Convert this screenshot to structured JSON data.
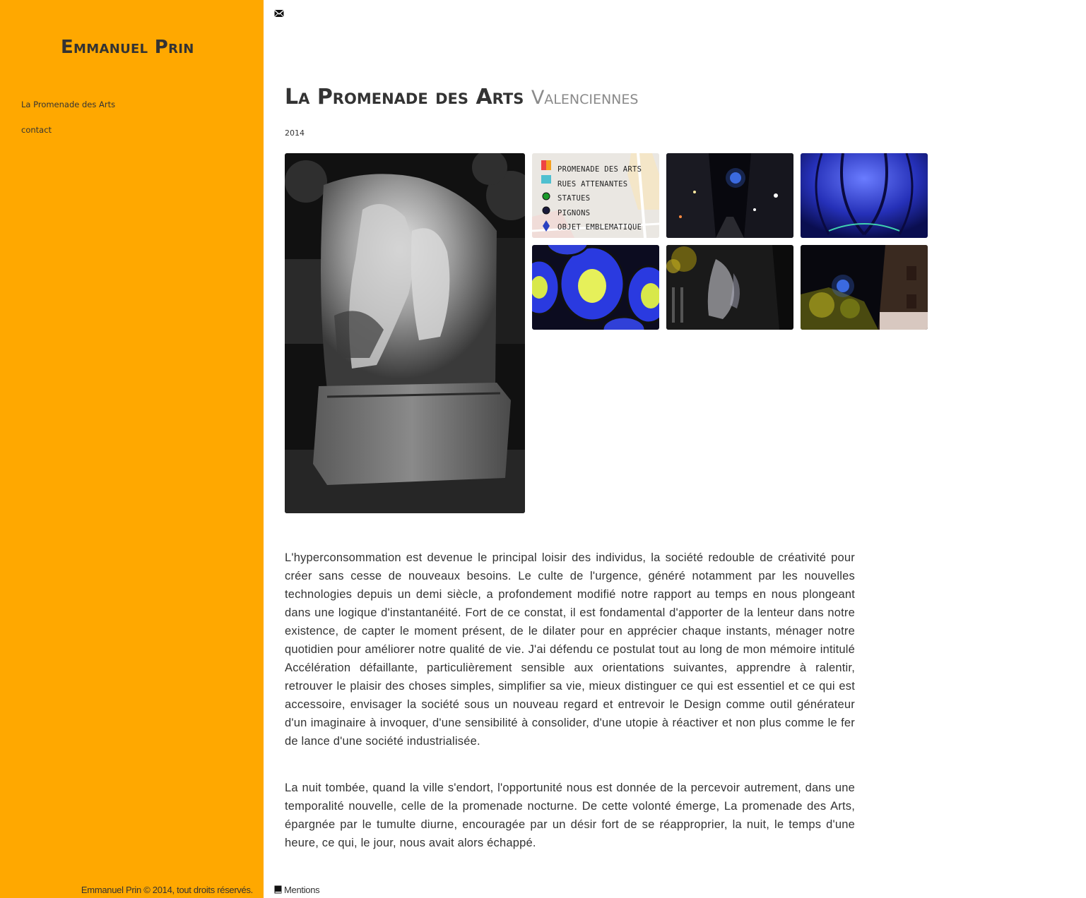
{
  "sidebar": {
    "title": "Emmanuel Prin",
    "nav": [
      {
        "label": "La Promenade des Arts"
      },
      {
        "label": "contact"
      }
    ],
    "copyright": "Emmanuel Prin © 2014, tout droits réservés."
  },
  "header": {
    "mail_icon": "envelope-icon"
  },
  "main": {
    "title": "La Promenade des Arts",
    "subtitle": "Valenciennes",
    "year": "2014",
    "map_legend": [
      "PROMENADE DES ARTS",
      "RUES ATTENANTES",
      "STATUES",
      "PIGNONS",
      "OBJET EMBLEMATIQUE"
    ],
    "paragraphs": [
      "L'hyperconsommation est devenue le principal loisir des individus, la société redouble de créativité pour créer sans cesse de nouveaux besoins. Le culte de l'urgence, généré notamment par les nouvelles technologies depuis un demi siècle, a profondement modifié notre rapport au temps en nous plongeant dans une logique d'instantanéité. Fort de ce constat, il est fondamental d'apporter de la lenteur dans notre existence, de capter le moment présent, de le dilater pour en apprécier chaque instants, ménager notre quotidien pour améliorer notre qualité de vie. J'ai défendu ce postulat tout au long de mon mémoire intitulé Accélération défaillante, particulièrement sensible aux orientations suivantes, apprendre à ralentir, retrouver le plaisir des choses simples, simplifier sa vie, mieux distinguer ce qui est essentiel et ce qui est accessoire, envisager la société sous un nouveau regard et entrevoir le Design comme outil générateur d'un imaginaire à invoquer, d'une sensibilité à consolider, d'une utopie à réactiver et non plus comme le fer de lance d'une société industrialisée.",
      "La nuit tombée, quand la ville s'endort, l'opportunité nous est donnée de la percevoir autrement, dans une temporalité nouvelle, celle de la promenade nocturne. De cette volonté émerge, La promenade des Arts, épargnée par le tumulte diurne, encouragée par un désir fort de se réapproprier, la nuit, le temps d'une heure, ce qui, le jour, nous avait alors échappé."
    ]
  },
  "footer": {
    "mentions": "Mentions",
    "mentions_icon": "book-icon"
  },
  "colors": {
    "sidebar_bg": "#FFA800",
    "text": "#333333",
    "subtitle": "#8a8a8a"
  }
}
